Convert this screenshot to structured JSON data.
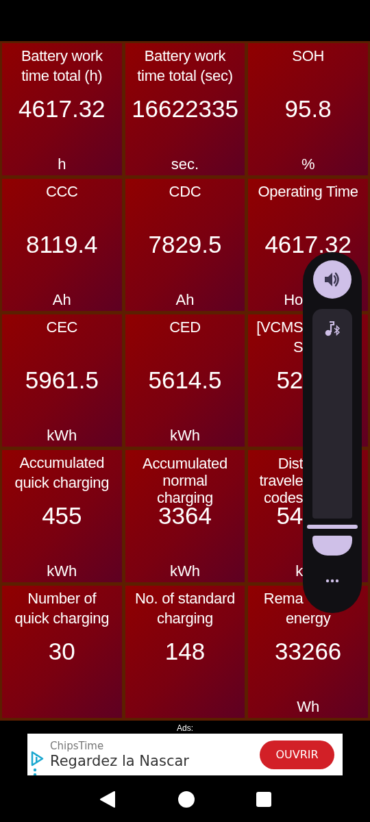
{
  "tiles": [
    {
      "label_lines": [
        {
          "text": "Battery work",
          "cut": false
        },
        {
          "text": "time total (h)",
          "cut": false
        }
      ],
      "value": {
        "text": "4617.32",
        "cut": false
      },
      "unit": {
        "text": "h",
        "cut": false
      }
    },
    {
      "label_lines": [
        {
          "text": "Battery work",
          "cut": false
        },
        {
          "text": "time total (sec)",
          "cut": false
        }
      ],
      "value": {
        "text": "16622335",
        "cut": false
      },
      "unit": {
        "text": "sec.",
        "cut": false
      }
    },
    {
      "label_lines": [
        {
          "text": "SOH",
          "cut": false
        }
      ],
      "value": {
        "text": "95.8",
        "cut": false
      },
      "unit": {
        "text": "%",
        "cut": false
      }
    },
    {
      "label_lines": [
        {
          "text": "CCC",
          "cut": false
        }
      ],
      "value": {
        "text": "8119.4",
        "cut": false
      },
      "unit": {
        "text": "Ah",
        "cut": false
      }
    },
    {
      "label_lines": [
        {
          "text": "CDC",
          "cut": false
        }
      ],
      "value": {
        "text": "7829.5",
        "cut": false
      },
      "unit": {
        "text": "Ah",
        "cut": false
      }
    },
    {
      "label_lines": [
        {
          "text": "Operating Time",
          "cut": false
        }
      ],
      "value": {
        "text": "4617.32",
        "cut": false
      },
      "unit": {
        "text": "Ho",
        "cut": true
      }
    },
    {
      "label_lines": [
        {
          "text": "CEC",
          "cut": false
        }
      ],
      "value": {
        "text": "5961.5",
        "cut": false
      },
      "unit": {
        "text": "kWh",
        "cut": false
      }
    },
    {
      "label_lines": [
        {
          "text": "CED",
          "cut": false
        }
      ],
      "value": {
        "text": "5614.5",
        "cut": false
      },
      "unit": {
        "text": "kWh",
        "cut": false
      }
    },
    {
      "label_lines": [
        {
          "text": "[VCMS",
          "cut": true
        },
        {
          "text": "S",
          "cut": true
        }
      ],
      "value": {
        "text": "52",
        "cut": true
      }
    },
    {
      "label_lines": [
        {
          "text": "Accumulated",
          "cut": false
        },
        {
          "text": "quick charging",
          "cut": false
        }
      ],
      "value": {
        "text": "455",
        "cut": false
      },
      "unit": {
        "text": "kWh",
        "cut": false
      }
    },
    {
      "label_lines": [
        {
          "text": "Accumulated",
          "cut": false
        },
        {
          "text": "normal",
          "cut": false
        },
        {
          "text": "charging",
          "cut": false
        }
      ],
      "value": {
        "text": "3364",
        "cut": false
      },
      "unit": {
        "text": "kWh",
        "cut": false
      }
    },
    {
      "label_lines": [
        {
          "text": "Dist",
          "cut": true
        },
        {
          "text": "travele",
          "cut": true
        },
        {
          "text": "codes",
          "cut": true
        }
      ],
      "value": {
        "text": "54",
        "cut": true
      },
      "unit": {
        "text": "k",
        "cut": true
      }
    },
    {
      "label_lines": [
        {
          "text": "Number of",
          "cut": false
        },
        {
          "text": "quick charging",
          "cut": false
        }
      ],
      "value": {
        "text": "30",
        "cut": false
      }
    },
    {
      "label_lines": [
        {
          "text": "No. of standard",
          "cut": false
        },
        {
          "text": "charging",
          "cut": false
        }
      ],
      "value": {
        "text": "148",
        "cut": false
      }
    },
    {
      "label_lines": [
        {
          "text": "Rema",
          "cut": true
        },
        {
          "text": "energy",
          "cut": false
        }
      ],
      "value": {
        "text": "33266",
        "cut": false
      },
      "unit": {
        "text": "Wh",
        "cut": false
      }
    }
  ],
  "volume_panel": {
    "level": 0.08
  },
  "ads_label": "Ads:",
  "ad": {
    "advertiser": "ChipsTime",
    "headline": "Regardez la Nascar",
    "button": "OUVRIR"
  }
}
